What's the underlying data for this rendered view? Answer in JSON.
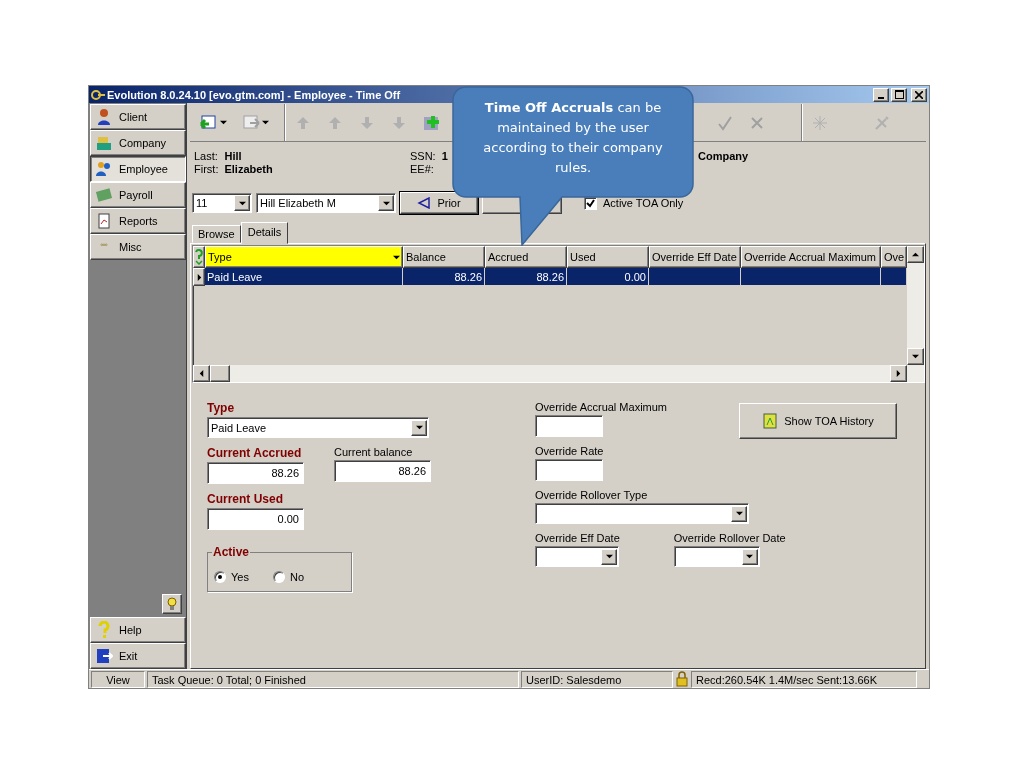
{
  "window": {
    "title": "Evolution 8.0.24.10 [evo.gtm.com] - Employee - Time Off"
  },
  "sidebar": {
    "items": [
      {
        "label": "Client",
        "selected": false
      },
      {
        "label": "Company",
        "selected": false
      },
      {
        "label": "Employee",
        "selected": true
      },
      {
        "label": "Payroll",
        "selected": false
      },
      {
        "label": "Reports",
        "selected": false
      },
      {
        "label": "Misc",
        "selected": false
      }
    ],
    "bottom_items": [
      {
        "label": "Help"
      },
      {
        "label": "Exit"
      }
    ]
  },
  "employee": {
    "last_label": "Last:",
    "last": "Hill",
    "first_label": "First:",
    "first": "Elizabeth",
    "ssn_label": "SSN:",
    "ssn": "1",
    "ee_label": "EE#:",
    "company": "Company"
  },
  "navigator": {
    "number": "11",
    "name": "Hill Elizabeth M",
    "prior": "Prior",
    "active_only": {
      "label": "Active TOA Only",
      "checked": true
    }
  },
  "tabs": [
    {
      "label": "Browse",
      "selected": false
    },
    {
      "label": "Details",
      "selected": true
    }
  ],
  "grid": {
    "columns": [
      "Type",
      "Balance",
      "Accrued",
      "Used",
      "Override Eff Date",
      "Override Accrual Maximum",
      "Ove"
    ],
    "rows": [
      {
        "selected": true,
        "cells": [
          "Paid Leave",
          "88.26",
          "88.26",
          "0.00",
          "",
          "",
          ""
        ]
      }
    ]
  },
  "form": {
    "type": {
      "label": "Type",
      "value": "Paid Leave"
    },
    "current_accrued": {
      "label": "Current Accrued",
      "value": "88.26"
    },
    "current_balance": {
      "label": "Current balance",
      "value": "88.26"
    },
    "current_used": {
      "label": "Current Used",
      "value": "0.00"
    },
    "active": {
      "label": "Active",
      "options": [
        {
          "label": "Yes",
          "selected": true
        },
        {
          "label": "No",
          "selected": false
        }
      ]
    },
    "override_accrual_maximum": {
      "label": "Override Accrual Maximum"
    },
    "override_rate": {
      "label": "Override Rate"
    },
    "override_rollover_type": {
      "label": "Override Rollover Type"
    },
    "override_eff_date": {
      "label": "Override Eff Date"
    },
    "override_rollover_date": {
      "label": "Override Rollover Date"
    },
    "history_button": "Show TOA History"
  },
  "callout": {
    "text": "**Time Off Accruals** can be maintained by the user according to their company rules."
  },
  "status_bar": [
    "View",
    "Task Queue: 0 Total; 0 Finished",
    "UserID: Salesdemo",
    "Recd:260.54K 1.4M/sec  Sent:13.66K"
  ]
}
